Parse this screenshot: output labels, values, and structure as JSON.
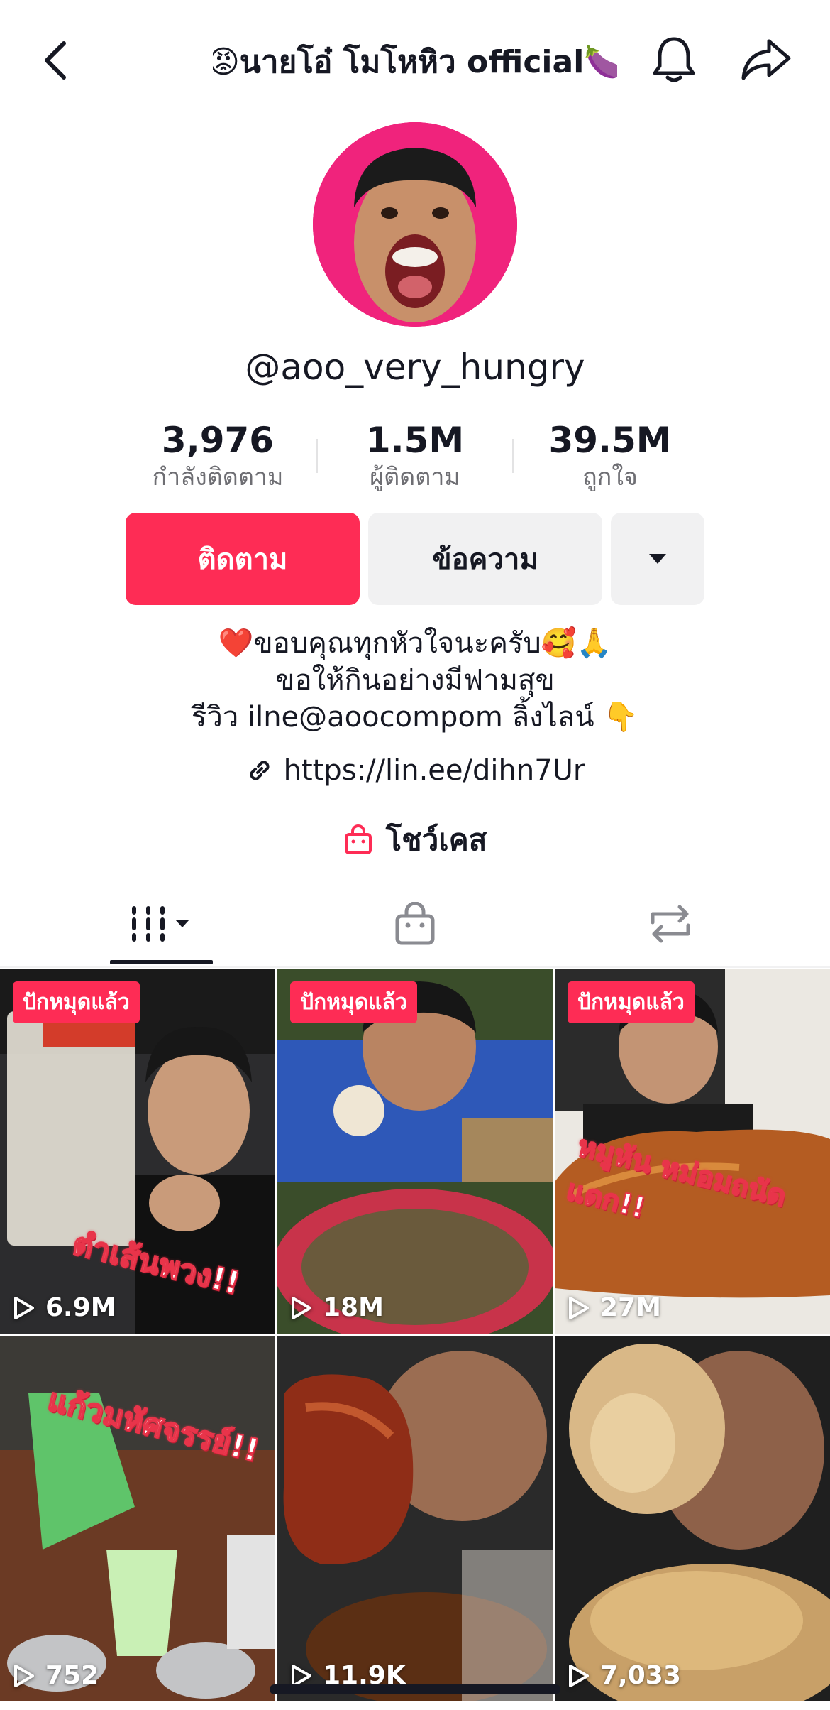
{
  "header": {
    "title": "😡นายโอ๋ โมโหหิว official🍆",
    "icons": {
      "back": "chevron-left-icon",
      "bell": "bell-icon",
      "share": "share-arrow-icon"
    }
  },
  "profile": {
    "username": "@aoo_very_hungry",
    "stats": [
      {
        "value": "3,976",
        "label": "กำลังติดตาม"
      },
      {
        "value": "1.5M",
        "label": "ผู้ติดตาม"
      },
      {
        "value": "39.5M",
        "label": "ถูกใจ"
      }
    ],
    "follow_label": "ติดตาม",
    "message_label": "ข้อความ",
    "bio": [
      "❤️ขอบคุณทุกหัวใจนะครับ🥰🙏",
      "ขอให้กินอย่างมีฟามสุข",
      "รีวิว ilne@aoocompom ลิ้งไลน์ 👇"
    ],
    "link": "https://lin.ee/dihn7Ur",
    "showcase_label": "โชว์เคส"
  },
  "tabs": {
    "active": "videos",
    "icons": [
      "videos-grid-icon",
      "shop-bag-icon",
      "repost-icon"
    ]
  },
  "videos": [
    {
      "badge": "ปักหมุดแล้ว",
      "views": "6.9M",
      "caption": "ตำเส้นพวง!!"
    },
    {
      "badge": "ปักหมุดแล้ว",
      "views": "18M",
      "caption": ""
    },
    {
      "badge": "ปักหมุดแล้ว",
      "views": "27M",
      "caption": "หมูหัน หม่อมถนัดแดก!!"
    },
    {
      "badge": "",
      "views": "752",
      "caption": "แก้วมหัศจรรย์!!"
    },
    {
      "badge": "",
      "views": "11.9K",
      "caption": ""
    },
    {
      "badge": "",
      "views": "7,033",
      "caption": ""
    }
  ],
  "colors": {
    "accent": "#fe2c55",
    "avatar_bg": "#f0237c",
    "secondary_button": "#f1f1f2",
    "muted_text": "#6e6e73"
  }
}
